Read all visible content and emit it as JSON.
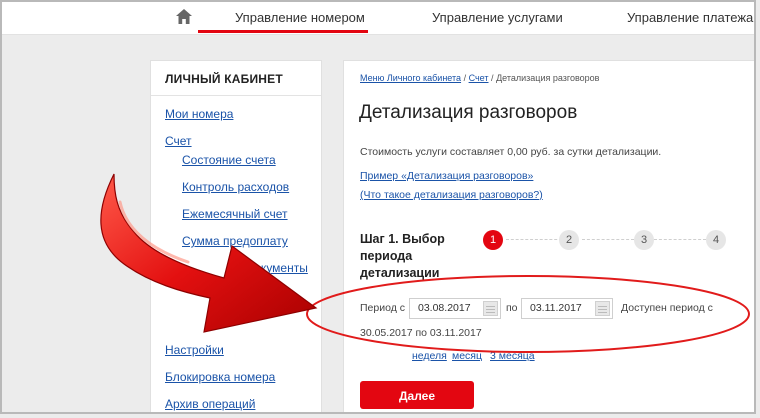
{
  "topnav": {
    "home_icon": "home-icon",
    "tabs": [
      {
        "label": "Управление номером",
        "active": true
      },
      {
        "label": "Управление услугами",
        "active": false
      },
      {
        "label": "Управление платежами",
        "active": false
      }
    ]
  },
  "sidebar": {
    "title": "ЛИЧНЫЙ КАБИНЕТ",
    "items": [
      {
        "label": "Мои номера"
      },
      {
        "label": "Счет"
      },
      {
        "label": "Состояние счета"
      },
      {
        "label": "Контроль расходов"
      },
      {
        "label": "Ежемесячный счет"
      },
      {
        "label": "Сумма предоплату"
      },
      {
        "label": "Документы"
      },
      {
        "label": "Настройки"
      },
      {
        "label": "Блокировка номера"
      },
      {
        "label": "Архив операций"
      }
    ]
  },
  "main": {
    "breadcrumb": {
      "item1": "Меню Личного кабинета",
      "sep": "/",
      "item2": "Счет",
      "item3": "Детализация разговоров"
    },
    "title": "Детализация разговоров",
    "cost_text": "Стоимость услуги составляет 0,00 руб. за сутки детализации.",
    "example_link": "Пример «Детализация разговоров»",
    "what_link": "(Что такое детализация разговоров?)",
    "step": {
      "title": "Шаг 1. Выбор периода детализации",
      "steps": [
        "1",
        "2",
        "3",
        "4"
      ],
      "active_step": 1
    },
    "period": {
      "from_label": "Период с",
      "from_value": "03.08.2017",
      "to_label": "по",
      "to_value": "03.11.2017",
      "available_text": "Доступен период с",
      "available_range": "30.05.2017 по 03.11.2017",
      "quick_links": [
        "неделя",
        "месяц",
        "3 месяца"
      ]
    },
    "next_button": "Далее"
  },
  "colors": {
    "accent": "#e30611",
    "link": "#1a53a8",
    "arrow": "#e01010"
  }
}
